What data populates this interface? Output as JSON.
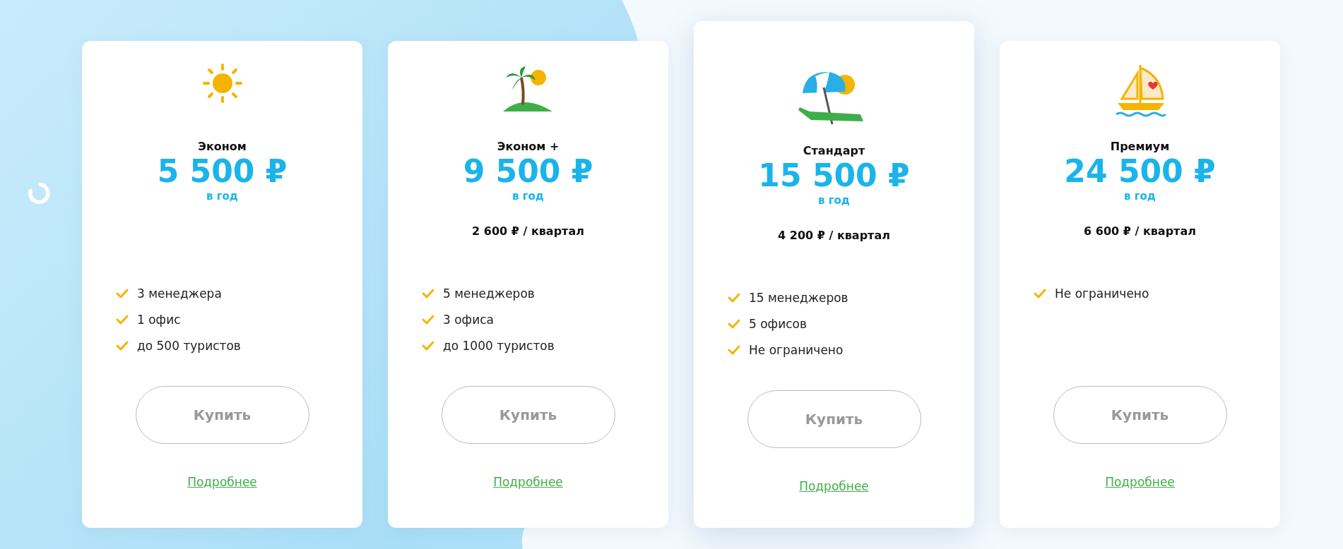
{
  "plans": [
    {
      "kind": "sun",
      "title": "Эконом",
      "price": "5 500 ₽",
      "period": "в год",
      "featured": false,
      "features": [
        "3 менеджера",
        "1 офис",
        "до 500 туристов"
      ],
      "button": "Купить",
      "link": "Подробнее"
    },
    {
      "kind": "palm",
      "title": "Эконом +",
      "price": "9 500 ₽",
      "period": "в год",
      "quarterly": "2 600 ₽ / квартал",
      "featured": false,
      "features": [
        "5 менеджеров",
        "3 офиса",
        "до 1000 туристов"
      ],
      "button": "Купить",
      "link": "Подробнее"
    },
    {
      "kind": "umbrella",
      "title": "Стандарт",
      "price": "15 500 ₽",
      "period": "в год",
      "quarterly": "4 200 ₽ / квартал",
      "featured": true,
      "features": [
        "15 менеджеров",
        "5 офисов",
        "Не ограничено"
      ],
      "button": "Купить",
      "link": "Подробнее"
    },
    {
      "kind": "boat",
      "title": "Премиум",
      "price": "24 500 ₽",
      "period": "в год",
      "quarterly": "6 600 ₽ / квартал",
      "featured": false,
      "features": [
        "Не ограничено"
      ],
      "button": "Купить",
      "link": "Подробнее"
    }
  ]
}
